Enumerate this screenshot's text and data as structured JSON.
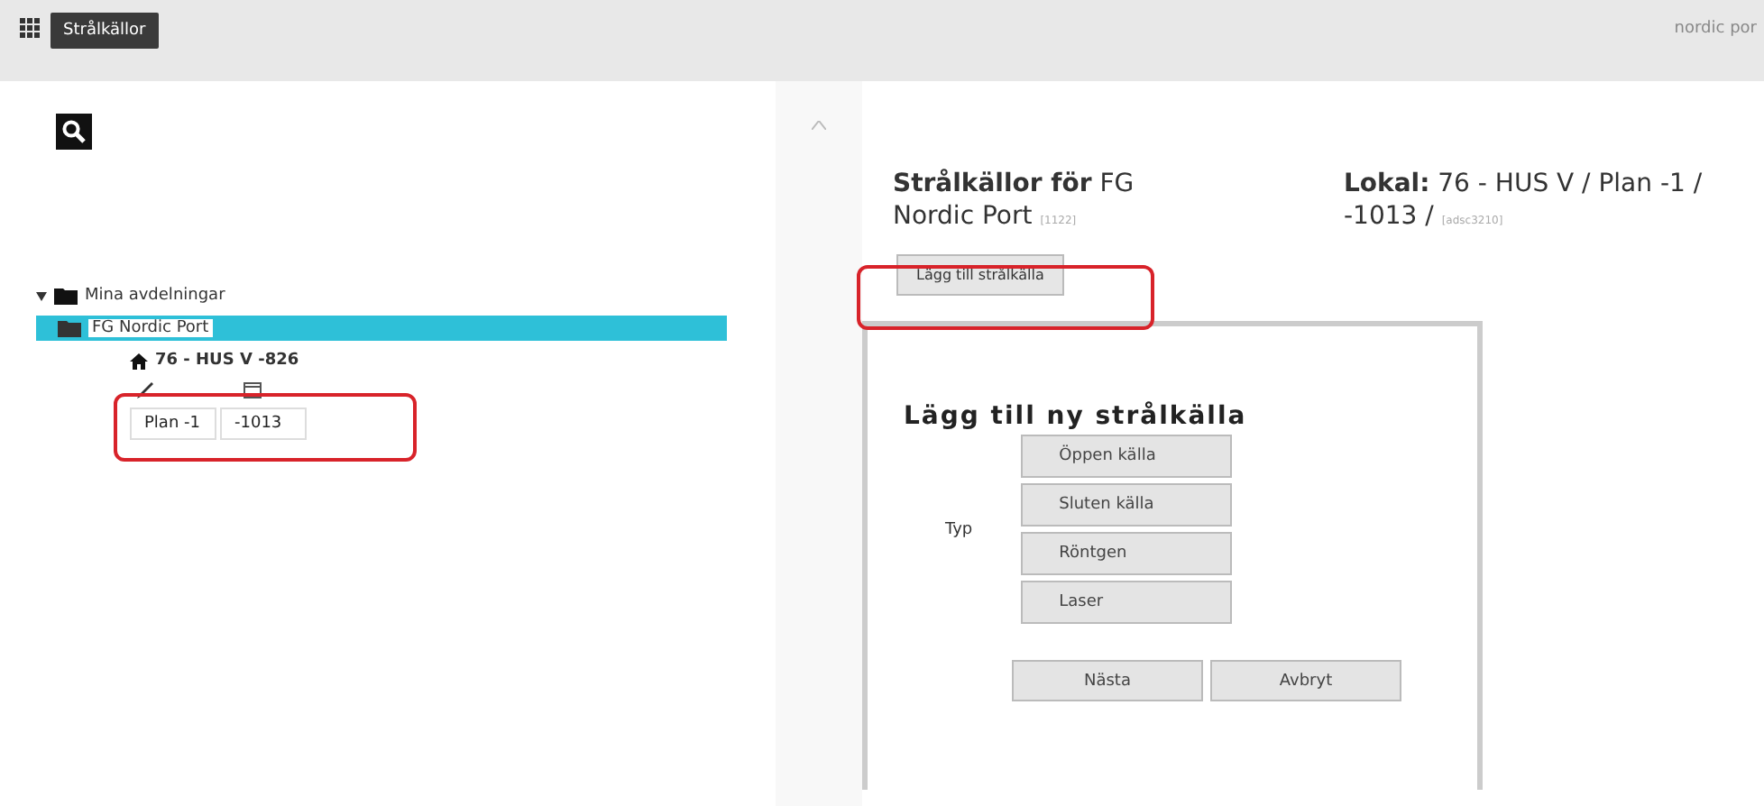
{
  "app_bar": {
    "title": "Strålkällor",
    "user": "nordic por"
  },
  "tree": {
    "label": "Mina avdelningar",
    "expanded": true,
    "departments": [
      {
        "label": "FG Nordic Port",
        "selected": true,
        "building": "76 - HUS V -826",
        "rooms": [
          "Plan -1",
          "-1013"
        ]
      }
    ]
  },
  "header": {
    "title": "**Strålkällor för** FG Nordic Port",
    "code": "[1122]",
    "location": "**Lokal:** 76 - HUS V / Plan -1 / -1013 /",
    "location_code": "[adsc3210]"
  },
  "add_button": "Lägg till strålkälla",
  "dialog": {
    "title": "Lägg till ny strålkälla",
    "type_label": "Typ",
    "types": [
      "Öppen källa",
      "Sluten källa",
      "Röntgen",
      "Laser"
    ],
    "buttons": [
      "Nästa",
      "Avbryt"
    ]
  }
}
